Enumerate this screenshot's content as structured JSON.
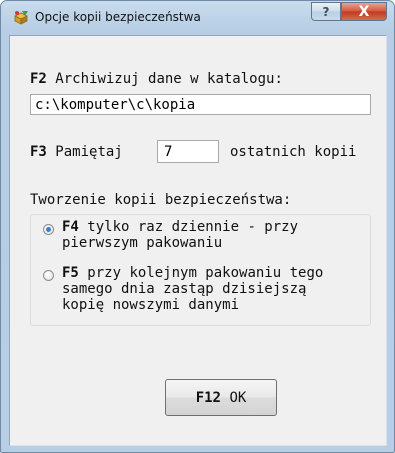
{
  "window": {
    "title": "Opcje kopii bezpieczeństwa",
    "icon": "backup-app-icon",
    "help_label": "?",
    "close_label": "X"
  },
  "archive": {
    "key": "F2",
    "label": "Archiwizuj dane w katalogu:",
    "path_value": "c:\\komputer\\c\\kopia"
  },
  "copies": {
    "key": "F3",
    "label_before": "Pamiętaj",
    "count_value": "7",
    "label_after": "ostatnich kopii"
  },
  "backup_creation": {
    "heading": "Tworzenie kopii bezpieczeństwa:",
    "options": [
      {
        "key": "F4",
        "text_line1": "tylko raz dziennie - przy",
        "text_line2": "pierwszym pakowaniu",
        "selected": true
      },
      {
        "key": "F5",
        "text_line1": "przy kolejnym pakowaniu tego",
        "text_line2": "samego dnia zastąp dzisiejszą",
        "text_line3": "kopię nowszymi danymi",
        "selected": false
      }
    ]
  },
  "ok_button": {
    "key": "F12",
    "label": "OK"
  },
  "colors": {
    "frame": "#b7cee5",
    "client": "#f0f0f0",
    "radio_selected": "#3a7fc8",
    "close_button": "#c0391f"
  }
}
